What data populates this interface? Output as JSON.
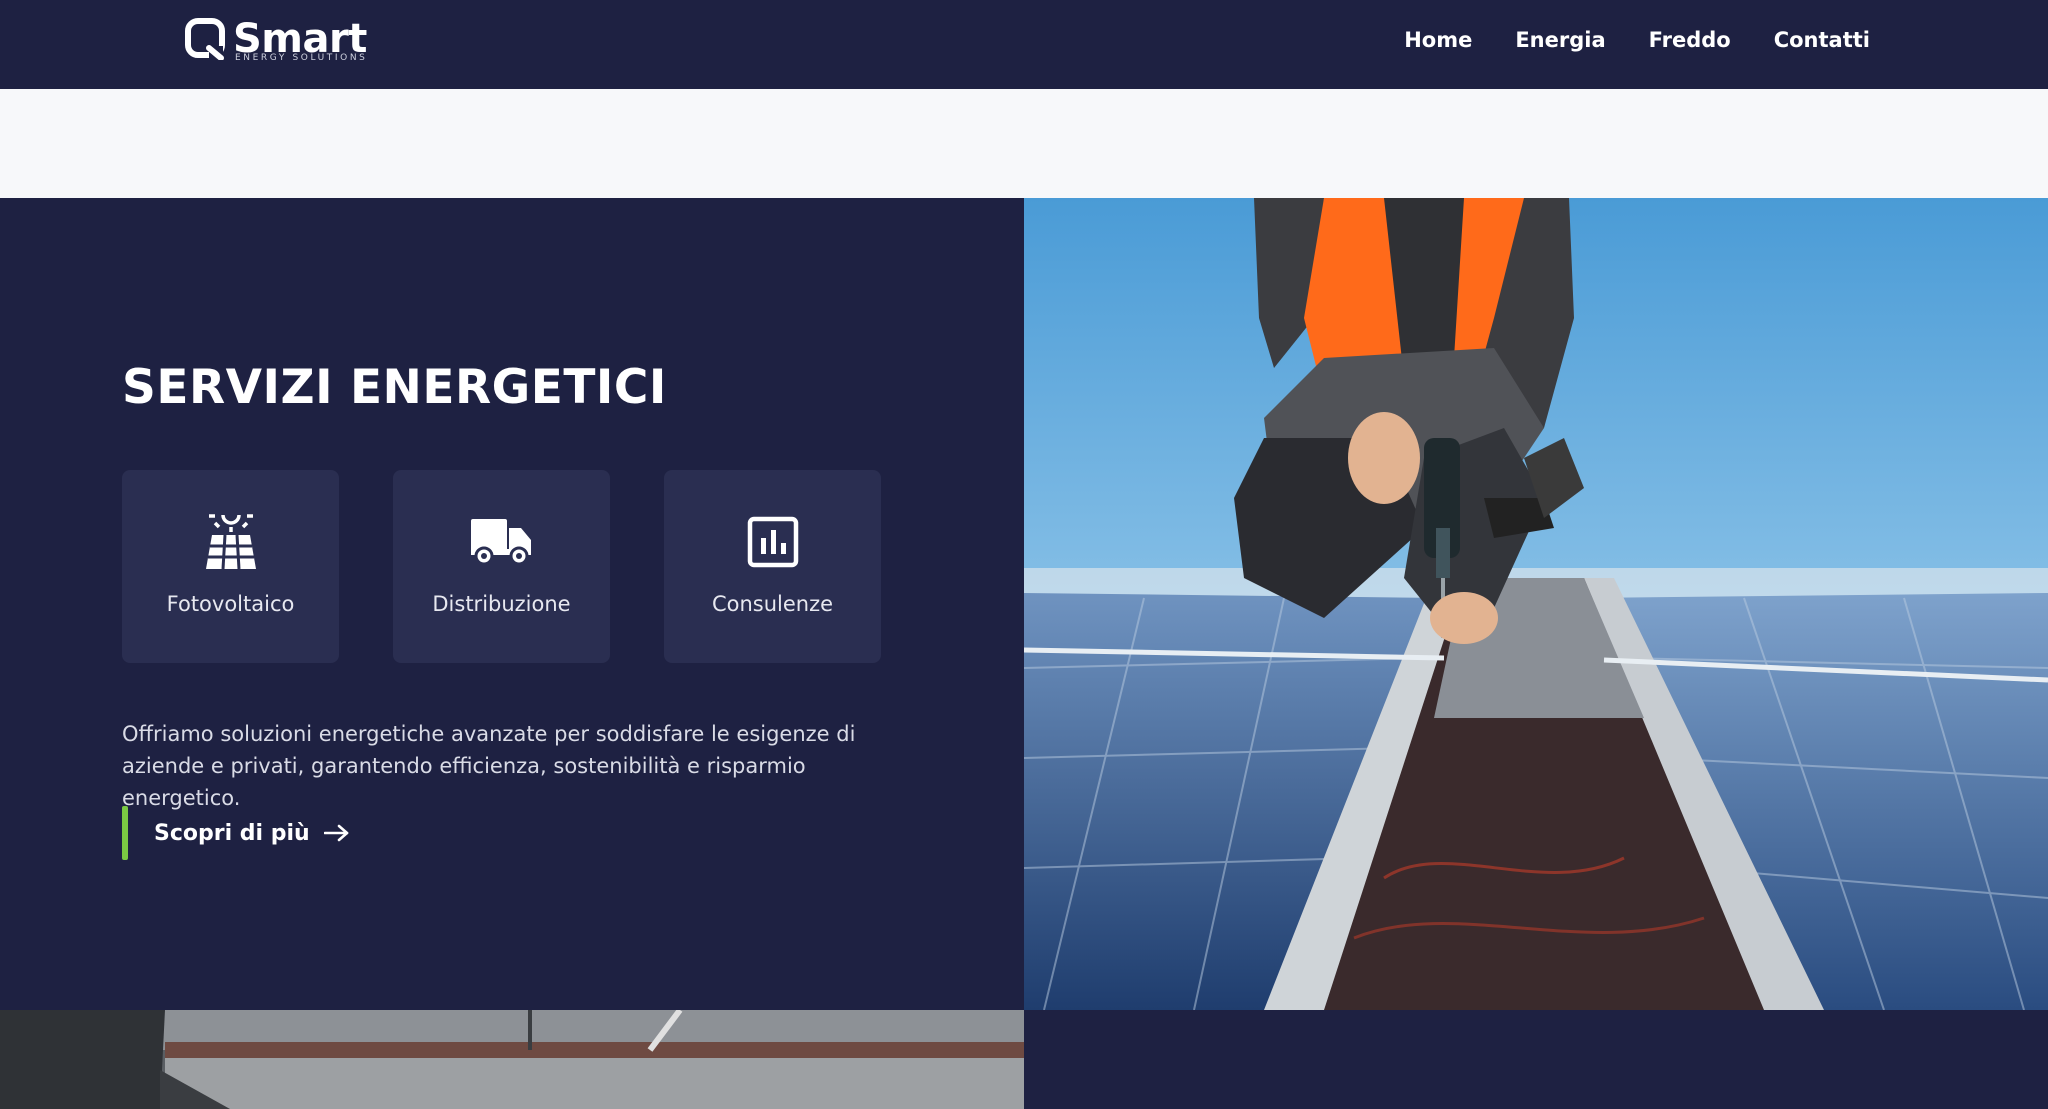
{
  "header": {
    "logo": {
      "name": "Smart",
      "tagline": "ENERGY SOLUTIONS"
    },
    "nav": [
      {
        "label": "Home"
      },
      {
        "label": "Energia"
      },
      {
        "label": "Freddo"
      },
      {
        "label": "Contatti"
      }
    ]
  },
  "hero": {
    "title": "SERVIZI ENERGETICI",
    "services": [
      {
        "label": "Fotovoltaico",
        "icon": "solar-panel-icon"
      },
      {
        "label": "Distribuzione",
        "icon": "truck-icon"
      },
      {
        "label": "Consulenze",
        "icon": "chart-icon"
      }
    ],
    "description": "Offriamo soluzioni energetiche avanzate per soddisfare le esigenze di aziende e privati, garantendo efficienza, sostenibilità e risparmio energetico.",
    "cta": {
      "label": "Scopri di più",
      "icon": "arrow-right-icon"
    }
  },
  "colors": {
    "navy": "#1e2142",
    "card": "#2a2e51",
    "accent_green": "#7ac943",
    "light_band": "#f7f8fa",
    "safety_orange": "#ff6a1a"
  }
}
